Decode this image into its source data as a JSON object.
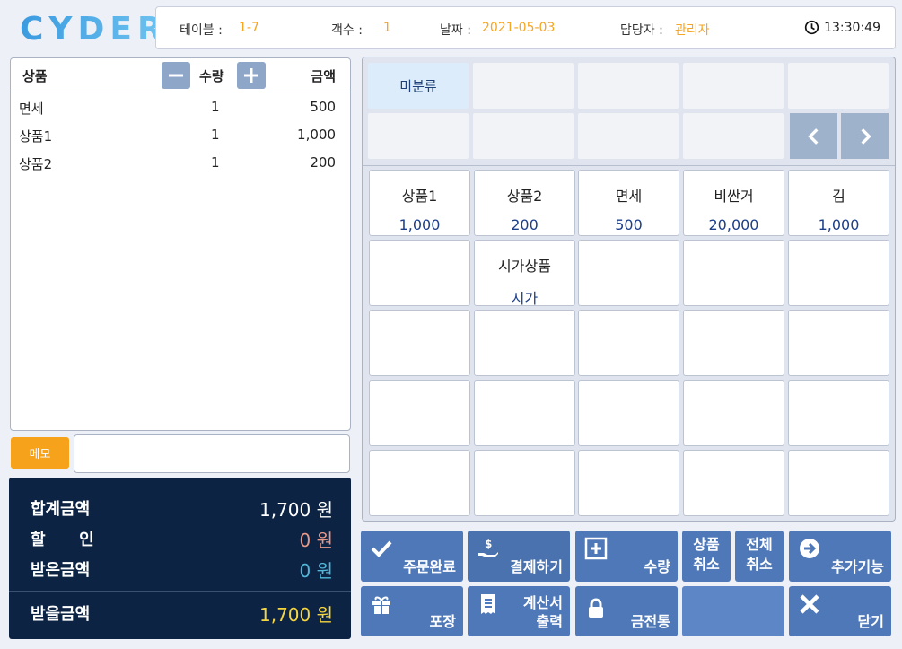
{
  "logo": "CYDER",
  "header": {
    "table_label": "테이블 :",
    "table_value": "1-7",
    "guests_label": "객수 :",
    "guests_value": "1",
    "date_label": "날짜 :",
    "date_value": "2021-05-03",
    "staff_label": "담당자 :",
    "staff_value": "관리자",
    "time": "13:30:49"
  },
  "order": {
    "col_product": "상품",
    "col_qty": "수량",
    "col_amount": "금액",
    "items": [
      {
        "name": "면세",
        "qty": "1",
        "amount": "500"
      },
      {
        "name": "상품1",
        "qty": "1",
        "amount": "1,000"
      },
      {
        "name": "상품2",
        "qty": "1",
        "amount": "200"
      }
    ]
  },
  "memo": {
    "button_label": "메모",
    "value": ""
  },
  "totals": {
    "sum_label": "합계금액",
    "sum_value": "1,700 원",
    "discount_label": "할      인",
    "discount_value": "0 원",
    "received_label": "받은금액",
    "received_value": "0 원",
    "due_label": "받을금액",
    "due_value": "1,700 원"
  },
  "categories": [
    {
      "label": "미분류",
      "selected": true
    }
  ],
  "products": [
    {
      "name": "상품1",
      "price": "1,000"
    },
    {
      "name": "상품2",
      "price": "200"
    },
    {
      "name": "면세",
      "price": "500"
    },
    {
      "name": "비싼거",
      "price": "20,000"
    },
    {
      "name": "김",
      "price": "1,000"
    },
    {
      "name": "",
      "price": ""
    },
    {
      "name": "시가상품",
      "price": "시가"
    }
  ],
  "actions": {
    "order_complete": "주문완료",
    "pay": "결제하기",
    "quantity": "수량",
    "cancel_item_1": "상품",
    "cancel_item_2": "취소",
    "cancel_all_1": "전체",
    "cancel_all_2": "취소",
    "extra": "추가기능",
    "packaging": "포장",
    "receipt_1": "계산서",
    "receipt_2": "출력",
    "cash_drawer": "금전통",
    "close": "닫기"
  },
  "colors": {
    "accent_orange": "#f7a21b",
    "navy": "#0d2344",
    "button_blue": "#4f78b8",
    "price_blue": "#1c3f8a"
  }
}
